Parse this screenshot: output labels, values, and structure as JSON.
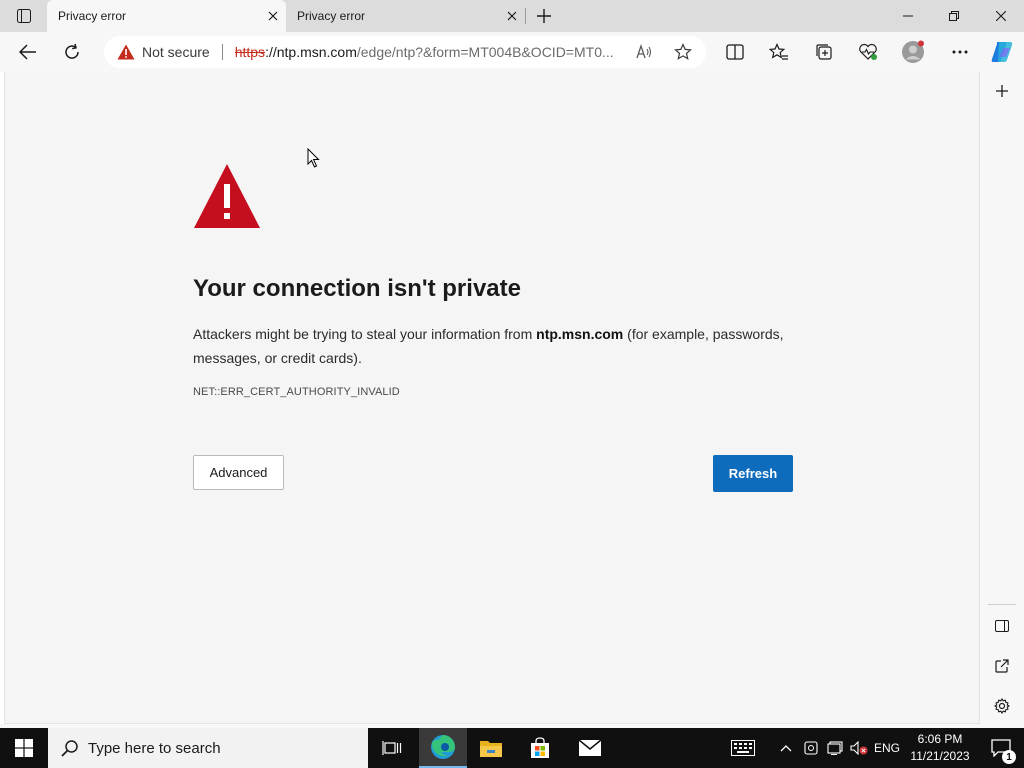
{
  "browser": {
    "tabs": [
      {
        "title": "Privacy error",
        "active": true
      },
      {
        "title": "Privacy error",
        "active": false
      }
    ],
    "address": {
      "security_label": "Not secure",
      "url_scheme": "https",
      "url_host": "://ntp.msn.com",
      "url_path": "/edge/ntp?&form=MT004B&OCID=MT0..."
    }
  },
  "page": {
    "heading": "Your connection isn't private",
    "body_prefix": "Attackers might be trying to steal your information from ",
    "body_host": "ntp.msn.com",
    "body_suffix": " (for example, passwords, messages, or credit cards).",
    "error_code": "NET::ERR_CERT_AUTHORITY_INVALID",
    "advanced_label": "Advanced",
    "refresh_label": "Refresh"
  },
  "taskbar": {
    "search_placeholder": "Type here to search",
    "language": "ENG",
    "time": "6:06 PM",
    "date": "11/21/2023",
    "notification_count": "1"
  },
  "colors": {
    "accent": "#0f6cbd",
    "warning_red": "#c42b1c",
    "taskbar_bg": "#101010"
  },
  "icons": [
    "tab-actions-icon",
    "close-icon",
    "plus-icon",
    "minimize-icon",
    "restore-icon",
    "back-icon",
    "refresh-icon",
    "warning-icon",
    "read-aloud-icon",
    "favorite-star-icon",
    "split-screen-icon",
    "favorites-icon",
    "collections-icon",
    "browser-essentials-icon",
    "profile-icon",
    "more-icon",
    "copilot-icon",
    "sidebar-icon",
    "external-link-icon",
    "settings-icon",
    "windows-logo-icon",
    "search-icon",
    "task-view-icon",
    "edge-icon",
    "file-explorer-icon",
    "store-icon",
    "mail-icon",
    "keyboard-icon",
    "chevron-up-icon",
    "camera-icon",
    "network-icon",
    "volume-muted-icon",
    "notification-icon"
  ]
}
